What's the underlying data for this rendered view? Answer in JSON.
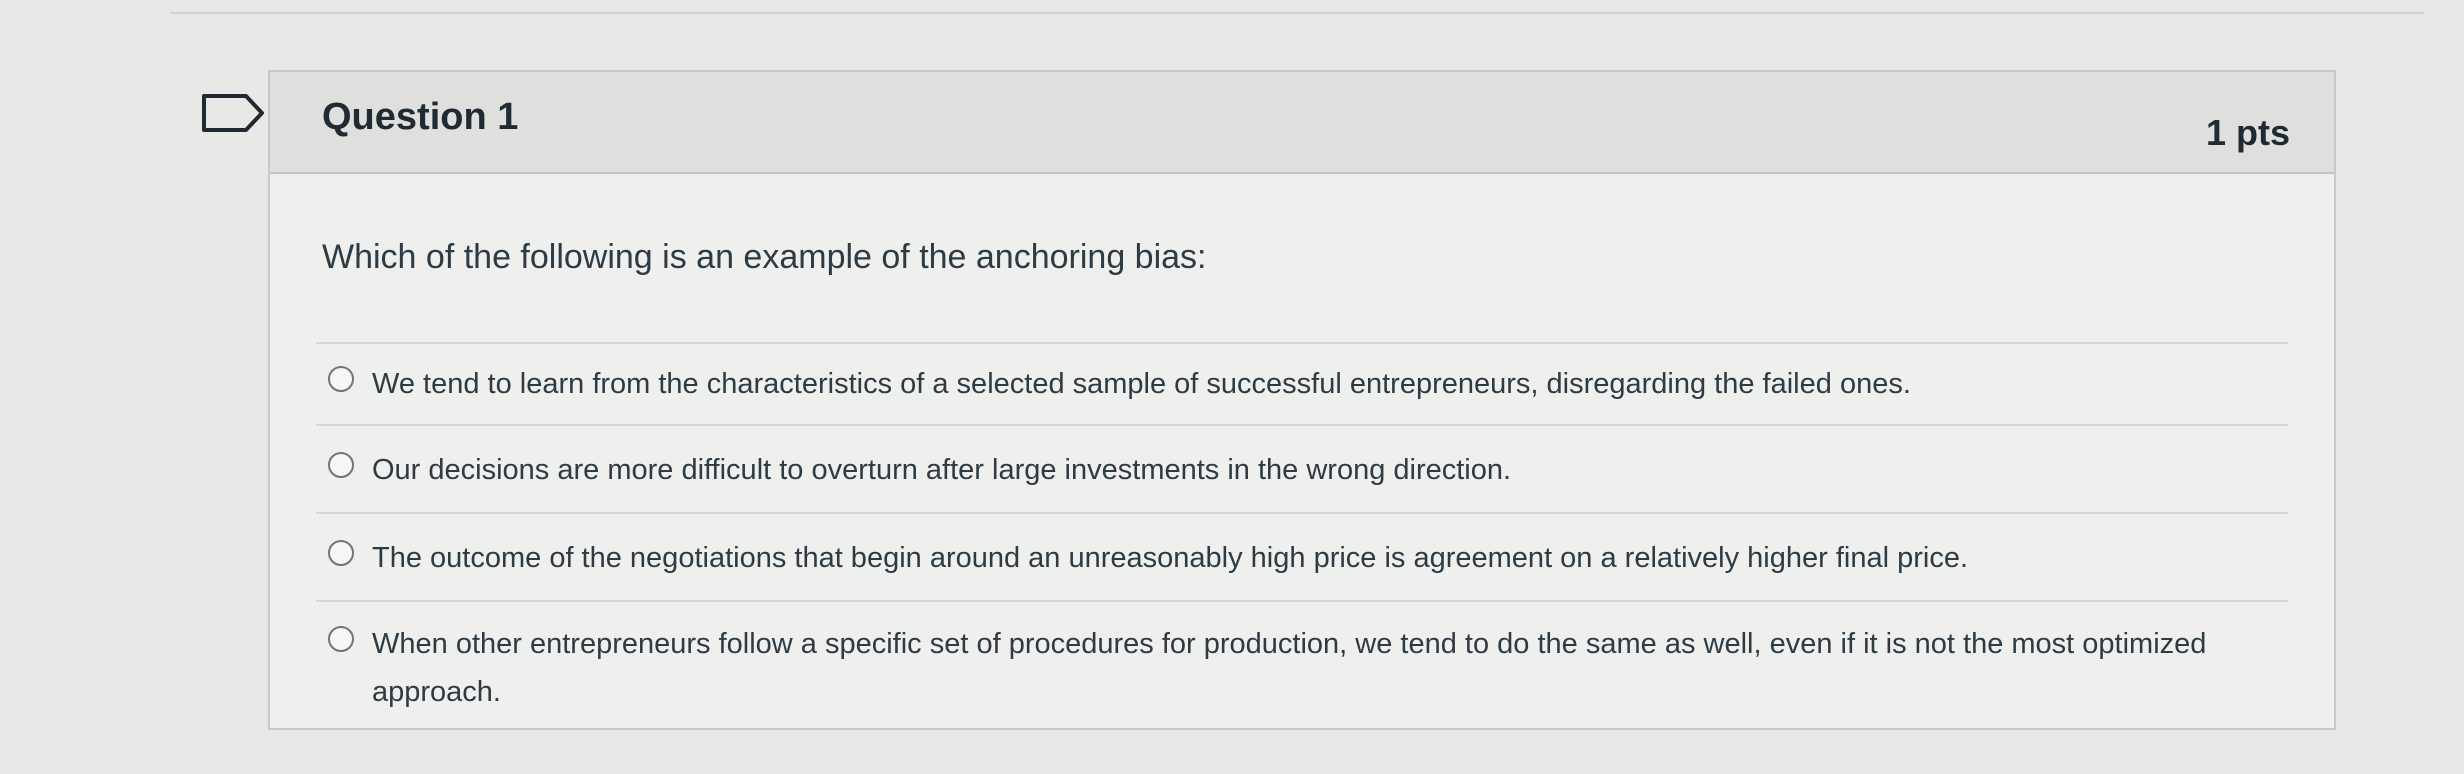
{
  "question": {
    "title": "Question 1",
    "points": "1 pts",
    "text": "Which of the following is an example of the anchoring bias:",
    "answers": [
      {
        "label": "We tend to learn from the characteristics of a selected sample of successful entrepreneurs, disregarding the failed ones."
      },
      {
        "label": "Our decisions are more difficult to overturn after large investments in the wrong direction."
      },
      {
        "label": "The outcome of the negotiations that begin around an unreasonably high price is agreement on a relatively higher final price."
      },
      {
        "label": "When other entrepreneurs follow a specific set of procedures for production, we tend to do the same as well, even if it is not the most optimized approach."
      }
    ]
  },
  "icons": {
    "flag": "bookmark-flag-icon",
    "radio": "radio-unselected-icon"
  },
  "colors": {
    "header_bg": "#dfdfdd",
    "card_bg": "#efefed",
    "text": "#2d3b45"
  }
}
